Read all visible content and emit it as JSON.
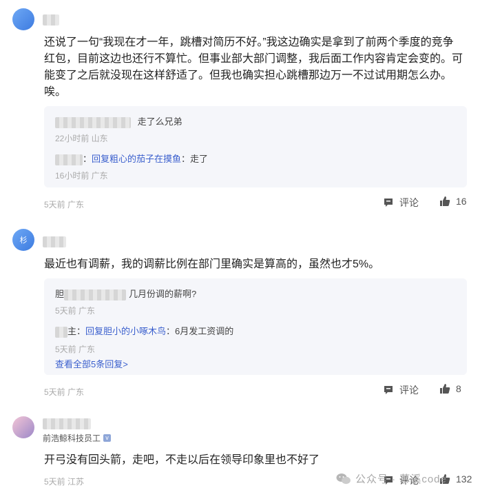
{
  "comments": [
    {
      "avatar_text": "",
      "body": "还说了一句“我现在才一年，跳槽对简历不好。”我这边确实是拿到了前两个季度的竞争红包，目前这边也还行不算忙。但事业部大部门调整，我后面工作内容肯定会变的。可能变了之后就没现在这样舒适了。但我也确实担心跳槽那边万一不过试用期怎么办。唉。",
      "replies": [
        {
          "text": "走了么兄弟",
          "meta": "22小时前 山东"
        },
        {
          "prefix": "：",
          "link": "回复粗心的茄子在摸鱼",
          "text": "：走了",
          "meta": "16小时前 广东"
        }
      ],
      "meta": "5天前 广东",
      "comment_label": "评论",
      "likes": "16"
    },
    {
      "avatar_text": "杉",
      "body": "最近也有调薪，我的调薪比例在部门里确实是算高的，虽然也才5%。",
      "replies": [
        {
          "name_start": "胆",
          "text": "几月份调的薪啊?",
          "meta": "5天前 广东"
        },
        {
          "prefix": "主：",
          "link": "回复胆小的小啄木鸟",
          "text": "：6月发工资调的",
          "meta": "5天前 广东"
        }
      ],
      "more": "查看全部5条回复>",
      "meta": "5天前 广东",
      "comment_label": "评论",
      "likes": "8"
    },
    {
      "badge": "前浩鲸科技员工",
      "verified_icon": "v",
      "body": "开弓没有回头箭，走吧，不走以后在领导印象里也不好了",
      "meta": "5天前 江苏",
      "comment_label": "评论",
      "likes": "132"
    }
  ],
  "watermark": "公众号 · 慕溪code",
  "icons": {
    "comment": "comment-icon",
    "like": "thumbs-up-icon",
    "wechat": "wechat-icon"
  }
}
